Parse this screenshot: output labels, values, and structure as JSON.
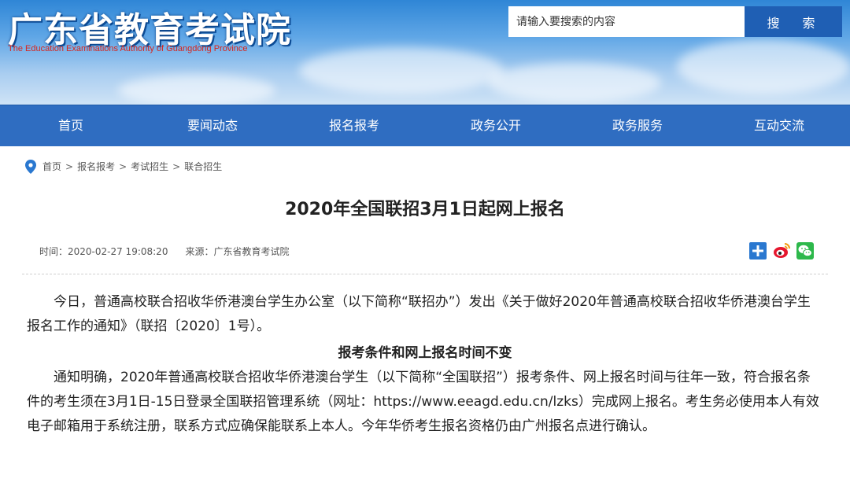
{
  "header": {
    "site_title": "广东省教育考试院",
    "site_subtitle": "The Education Examinations Authority of Guangdong Province",
    "search_placeholder": "请输入要搜索的内容",
    "search_button": "搜 索"
  },
  "nav": {
    "items": [
      {
        "label": "首页"
      },
      {
        "label": "要闻动态"
      },
      {
        "label": "报名报考"
      },
      {
        "label": "政务公开"
      },
      {
        "label": "政务服务"
      },
      {
        "label": "互动交流"
      }
    ]
  },
  "breadcrumb": {
    "items": [
      "首页",
      "报名报考",
      "考试招生",
      "联合招生"
    ],
    "separator": ">"
  },
  "article": {
    "title": "2020年全国联招3月1日起网上报名",
    "time": "时间：2020-02-27 19:08:20",
    "source": "来源：广东省教育考试院",
    "para1": "今日，普通高校联合招收华侨港澳台学生办公室（以下简称“联招办”）发出《关于做好2020年普通高校联合招收华侨港澳台学生报名工作的通知》（联招〔2020〕1号）。",
    "subhead": "报考条件和网上报名时间不变",
    "para2": "通知明确，2020年普通高校联合招收华侨港澳台学生（以下简称“全国联招”）报考条件、网上报名时间与往年一致，符合报名条件的考生须在3月1日-15日登录全国联招管理系统（网址：https://www.eeagd.edu.cn/lzks）完成网上报名。考生务必使用本人有效电子邮箱用于系统注册，联系方式应确保能联系上本人。今年华侨考生报名资格仍由广州报名点进行确认。"
  },
  "share": {
    "icons": [
      "plus-share-icon",
      "weibo-icon",
      "wechat-icon"
    ]
  },
  "colors": {
    "nav_bg": "#2f6dc1",
    "search_button_bg": "#1f5fb4",
    "subtitle_red": "#d7251d",
    "pin_blue": "#2a78d0"
  }
}
